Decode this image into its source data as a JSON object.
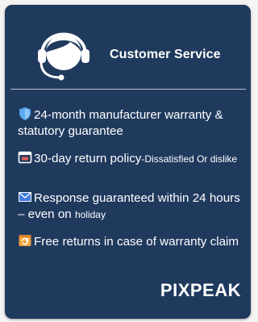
{
  "header": {
    "title": "Customer Service",
    "icon": "headset-agent-icon"
  },
  "features": [
    {
      "icon": "shield-icon",
      "text": "24-month manufacturer warranty & statutory guarantee"
    },
    {
      "icon": "return-box-icon",
      "text": "30-day return policy",
      "small_text": "-Dissatisfied Or dislike"
    },
    {
      "icon": "envelope-icon",
      "text": "Response guaranteed within 24 hours – even on ",
      "small_text": "holiday"
    },
    {
      "icon": "package-return-icon",
      "text": "Free returns in case of warranty claim"
    }
  ],
  "brand": {
    "name": "PIXPEAK"
  },
  "colors": {
    "card_background": "#203a5e",
    "text": "#ffffff",
    "shield_icon": "#5aa9f0",
    "return_icon": "#e0605a",
    "envelope_icon": "#3d7be0",
    "package_icon": "#f2a23a"
  }
}
